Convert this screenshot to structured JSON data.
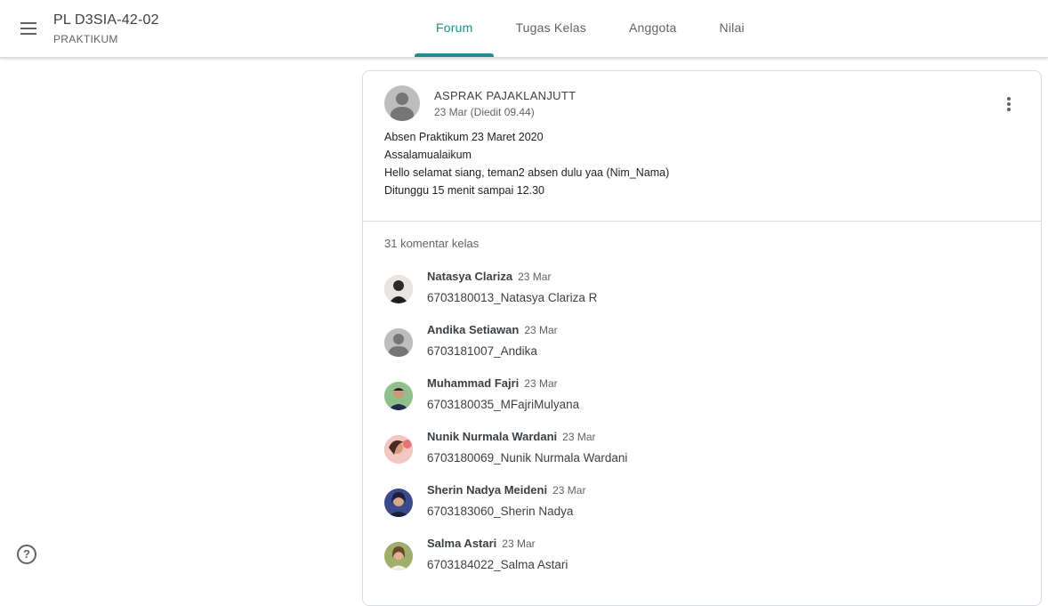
{
  "header": {
    "class_title": "PL D3SIA-42-02",
    "class_subtitle": "PRAKTIKUM",
    "tabs": [
      {
        "label": "Forum"
      },
      {
        "label": "Tugas Kelas"
      },
      {
        "label": "Anggota"
      },
      {
        "label": "Nilai"
      }
    ],
    "active_tab": "Forum",
    "accent_color": "#1e8e8e"
  },
  "post": {
    "author": "ASPRAK PAJAKLANJUTT",
    "date": "23 Mar (Diedit 09.44)",
    "lines": [
      "Absen Praktikum 23 Maret 2020",
      "Assalamualaikum",
      "Hello selamat siang, teman2 absen dulu yaa (Nim_Nama)",
      "Ditunggu 15 menit sampai 12.30"
    ]
  },
  "comments_section": {
    "count_label": "31 komentar kelas",
    "comments": [
      {
        "name": "Natasya Clariza",
        "date": "23 Mar",
        "text": "6703180013_Natasya Clariza R",
        "avatar": "photo"
      },
      {
        "name": "Andika Setiawan",
        "date": "23 Mar",
        "text": "6703181007_Andika",
        "avatar": "default"
      },
      {
        "name": "Muhammad Fajri",
        "date": "23 Mar",
        "text": "6703180035_MFajriMulyana",
        "avatar": "photo"
      },
      {
        "name": "Nunik Nurmala Wardani",
        "date": "23 Mar",
        "text": "6703180069_Nunik Nurmala Wardani",
        "avatar": "photo"
      },
      {
        "name": "Sherin Nadya Meideni",
        "date": "23 Mar",
        "text": "6703183060_Sherin Nadya",
        "avatar": "photo"
      },
      {
        "name": "Salma Astari",
        "date": "23 Mar",
        "text": "6703184022_Salma Astari",
        "avatar": "photo"
      }
    ]
  },
  "icons": {
    "menu": "hamburger-menu-icon",
    "more": "more-vertical-icon",
    "help": "help-icon"
  }
}
